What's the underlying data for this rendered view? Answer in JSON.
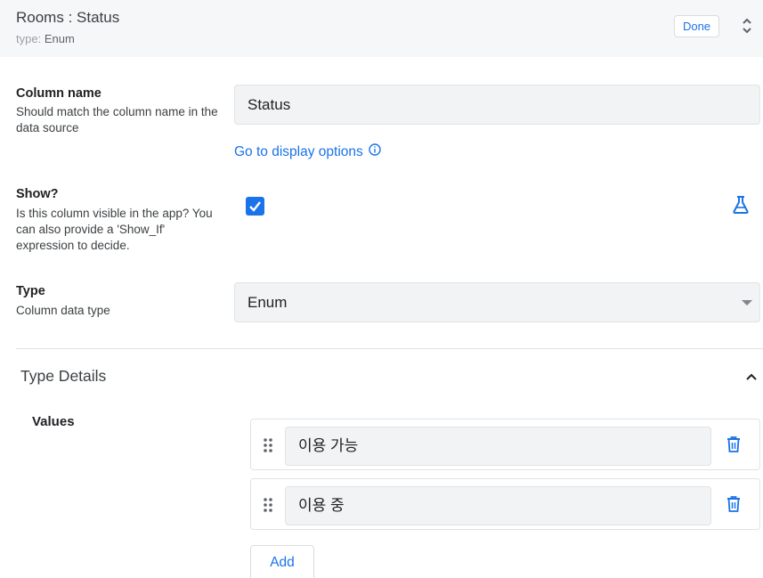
{
  "header": {
    "title": "Rooms : Status",
    "type_label": "type:",
    "type_value": "Enum",
    "done_label": "Done"
  },
  "column_name": {
    "label": "Column name",
    "description": "Should match the column name in the data source",
    "value": "Status",
    "link": "Go to display options"
  },
  "show": {
    "label": "Show?",
    "description": "Is this column visible in the app? You can also provide a 'Show_If' expression to decide.",
    "checked": true
  },
  "type": {
    "label": "Type",
    "description": "Column data type",
    "value": "Enum"
  },
  "type_details": {
    "title": "Type Details",
    "values_label": "Values",
    "values": [
      "이용 가능",
      "이용 중"
    ],
    "add_label": "Add"
  },
  "colors": {
    "accent": "#1a73e8",
    "header_bg": "#f6f7f9",
    "input_bg": "#f1f3f4"
  }
}
